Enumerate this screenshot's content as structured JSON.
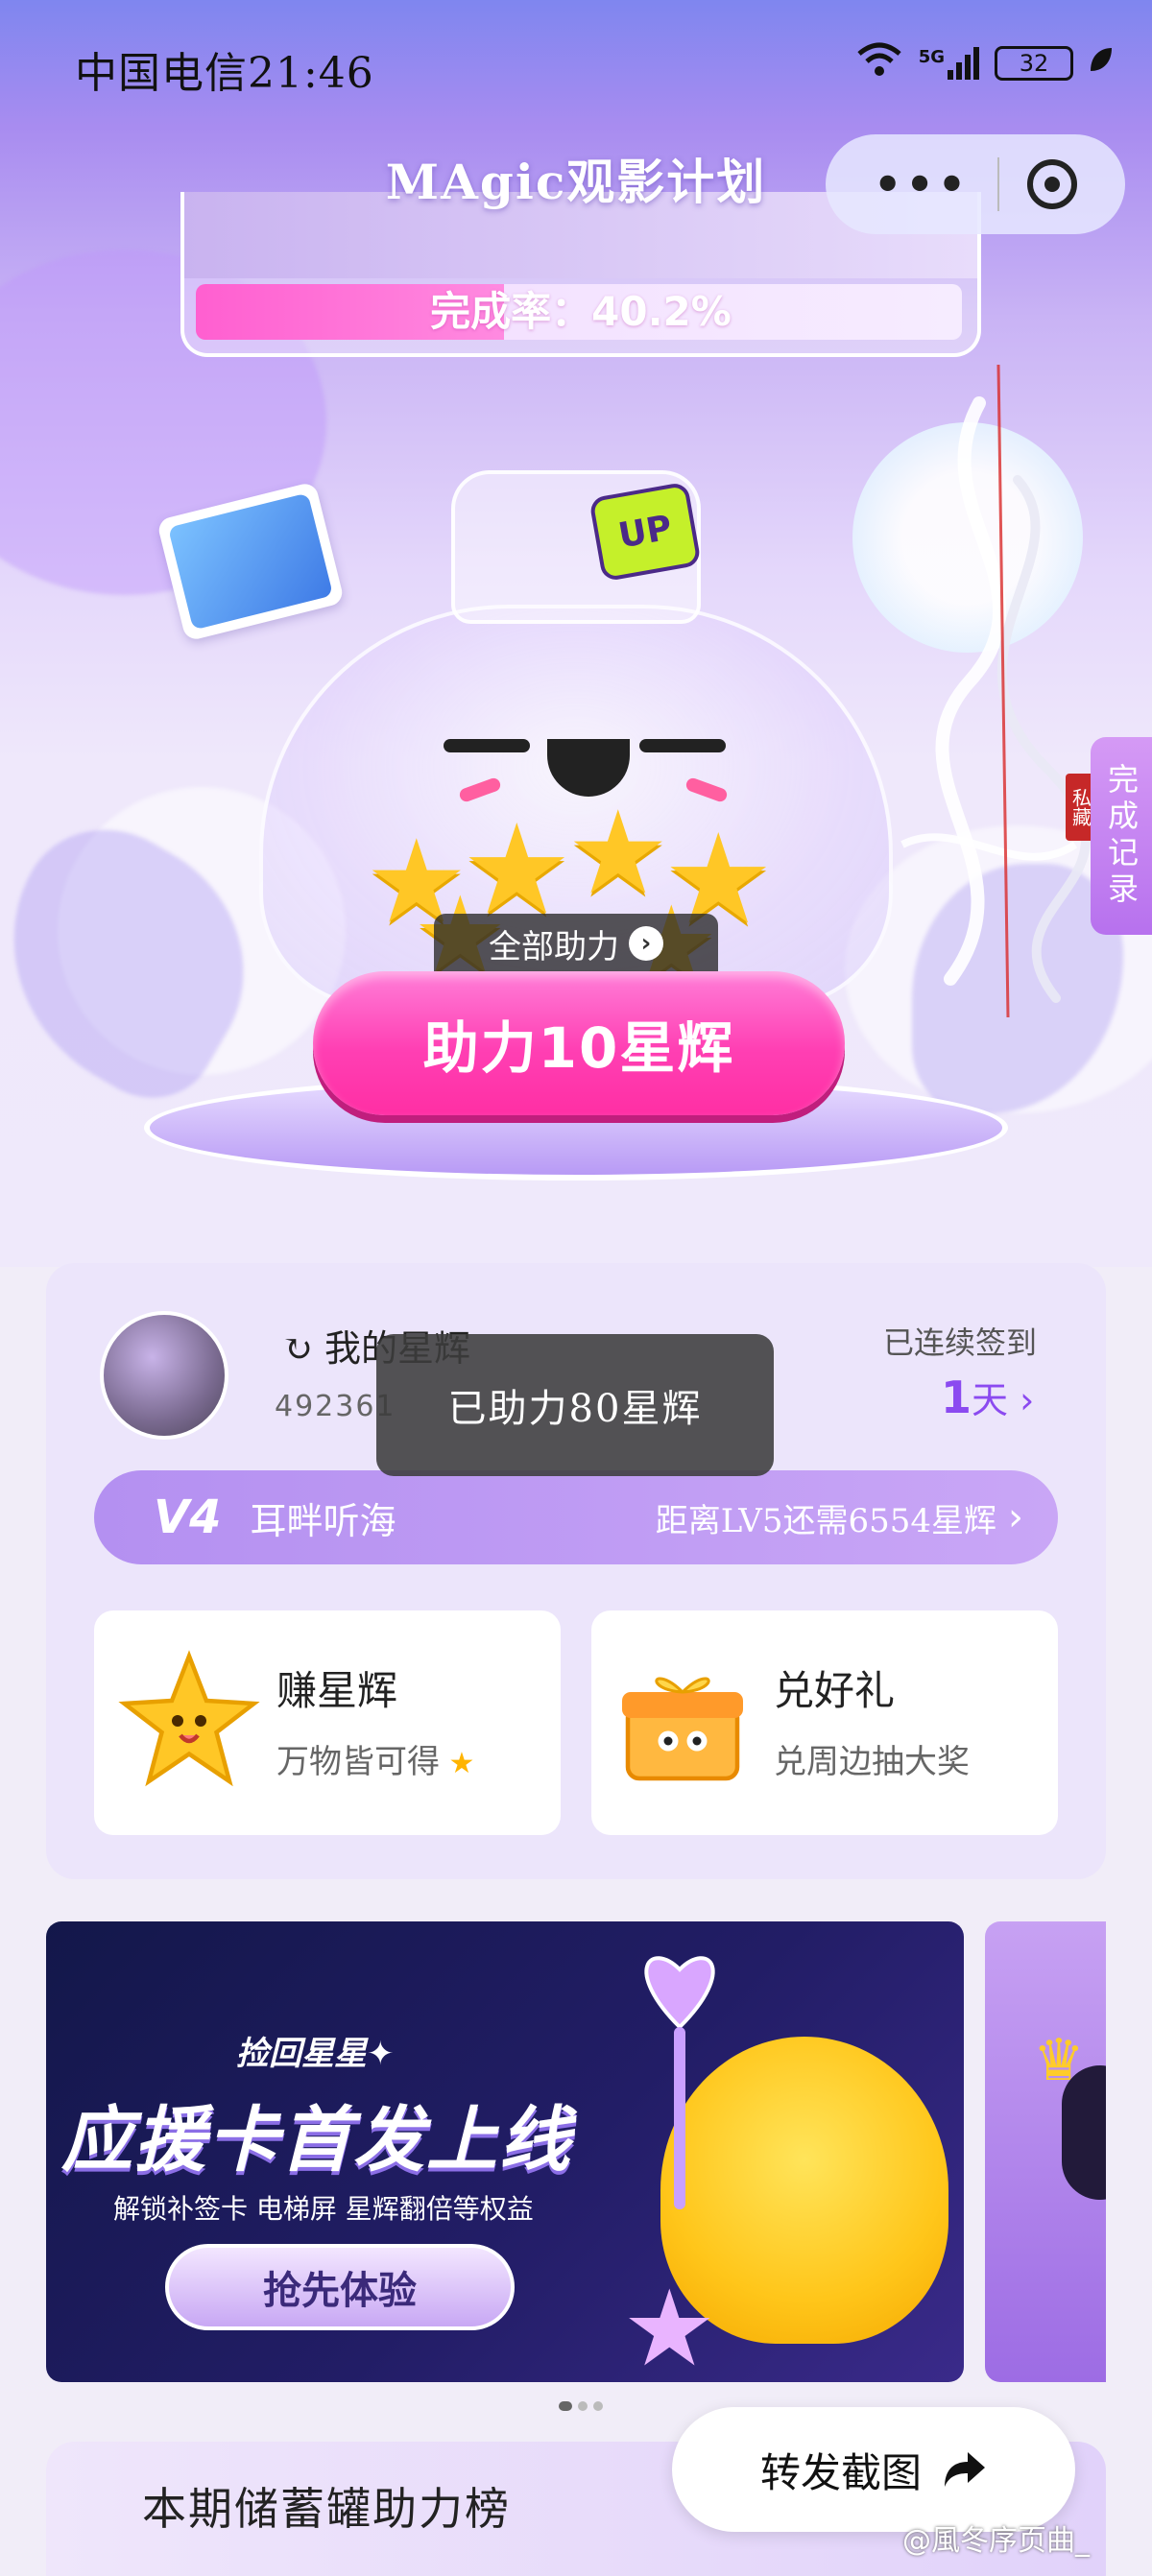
{
  "status_bar": {
    "carrier_time": "中国电信21:46",
    "network": "5G",
    "battery": "32"
  },
  "header": {
    "title": "MAgic观影计划"
  },
  "completion": {
    "text": "完成率：40.2%",
    "rate_percent": 40.2
  },
  "jar": {
    "badge": "UP"
  },
  "actions": {
    "help_all": "全部助力",
    "boost_button": "助力10星辉"
  },
  "side": {
    "record_label": "完成记录",
    "seal_text": "私藏"
  },
  "user": {
    "name": "我的星辉",
    "id": "492361",
    "checkin_label": "已连续签到",
    "checkin_days": "1",
    "checkin_unit": "天",
    "level_badge": "V4",
    "level_name": "耳畔听海",
    "level_next": "距离LV5还需6554星辉"
  },
  "toast": "已助力80星辉",
  "tiles": {
    "earn": {
      "title": "赚星辉",
      "subtitle": "万物皆可得"
    },
    "redeem": {
      "title": "兑好礼",
      "subtitle": "兑周边抽大奖"
    }
  },
  "banner": {
    "kicker": "捡回星星✦",
    "title": "应援卡首发上线",
    "subtitle": "解锁补签卡 电梯屏 星辉翻倍等权益",
    "cta": "抢先体验"
  },
  "bottom": {
    "rank_title": "本期储蓄罐助力榜",
    "share_button": "转发截图",
    "watermark": "@風冬序页曲_"
  },
  "colors": {
    "accent_pink": "#ff3fb3",
    "accent_purple": "#8b4af0"
  }
}
